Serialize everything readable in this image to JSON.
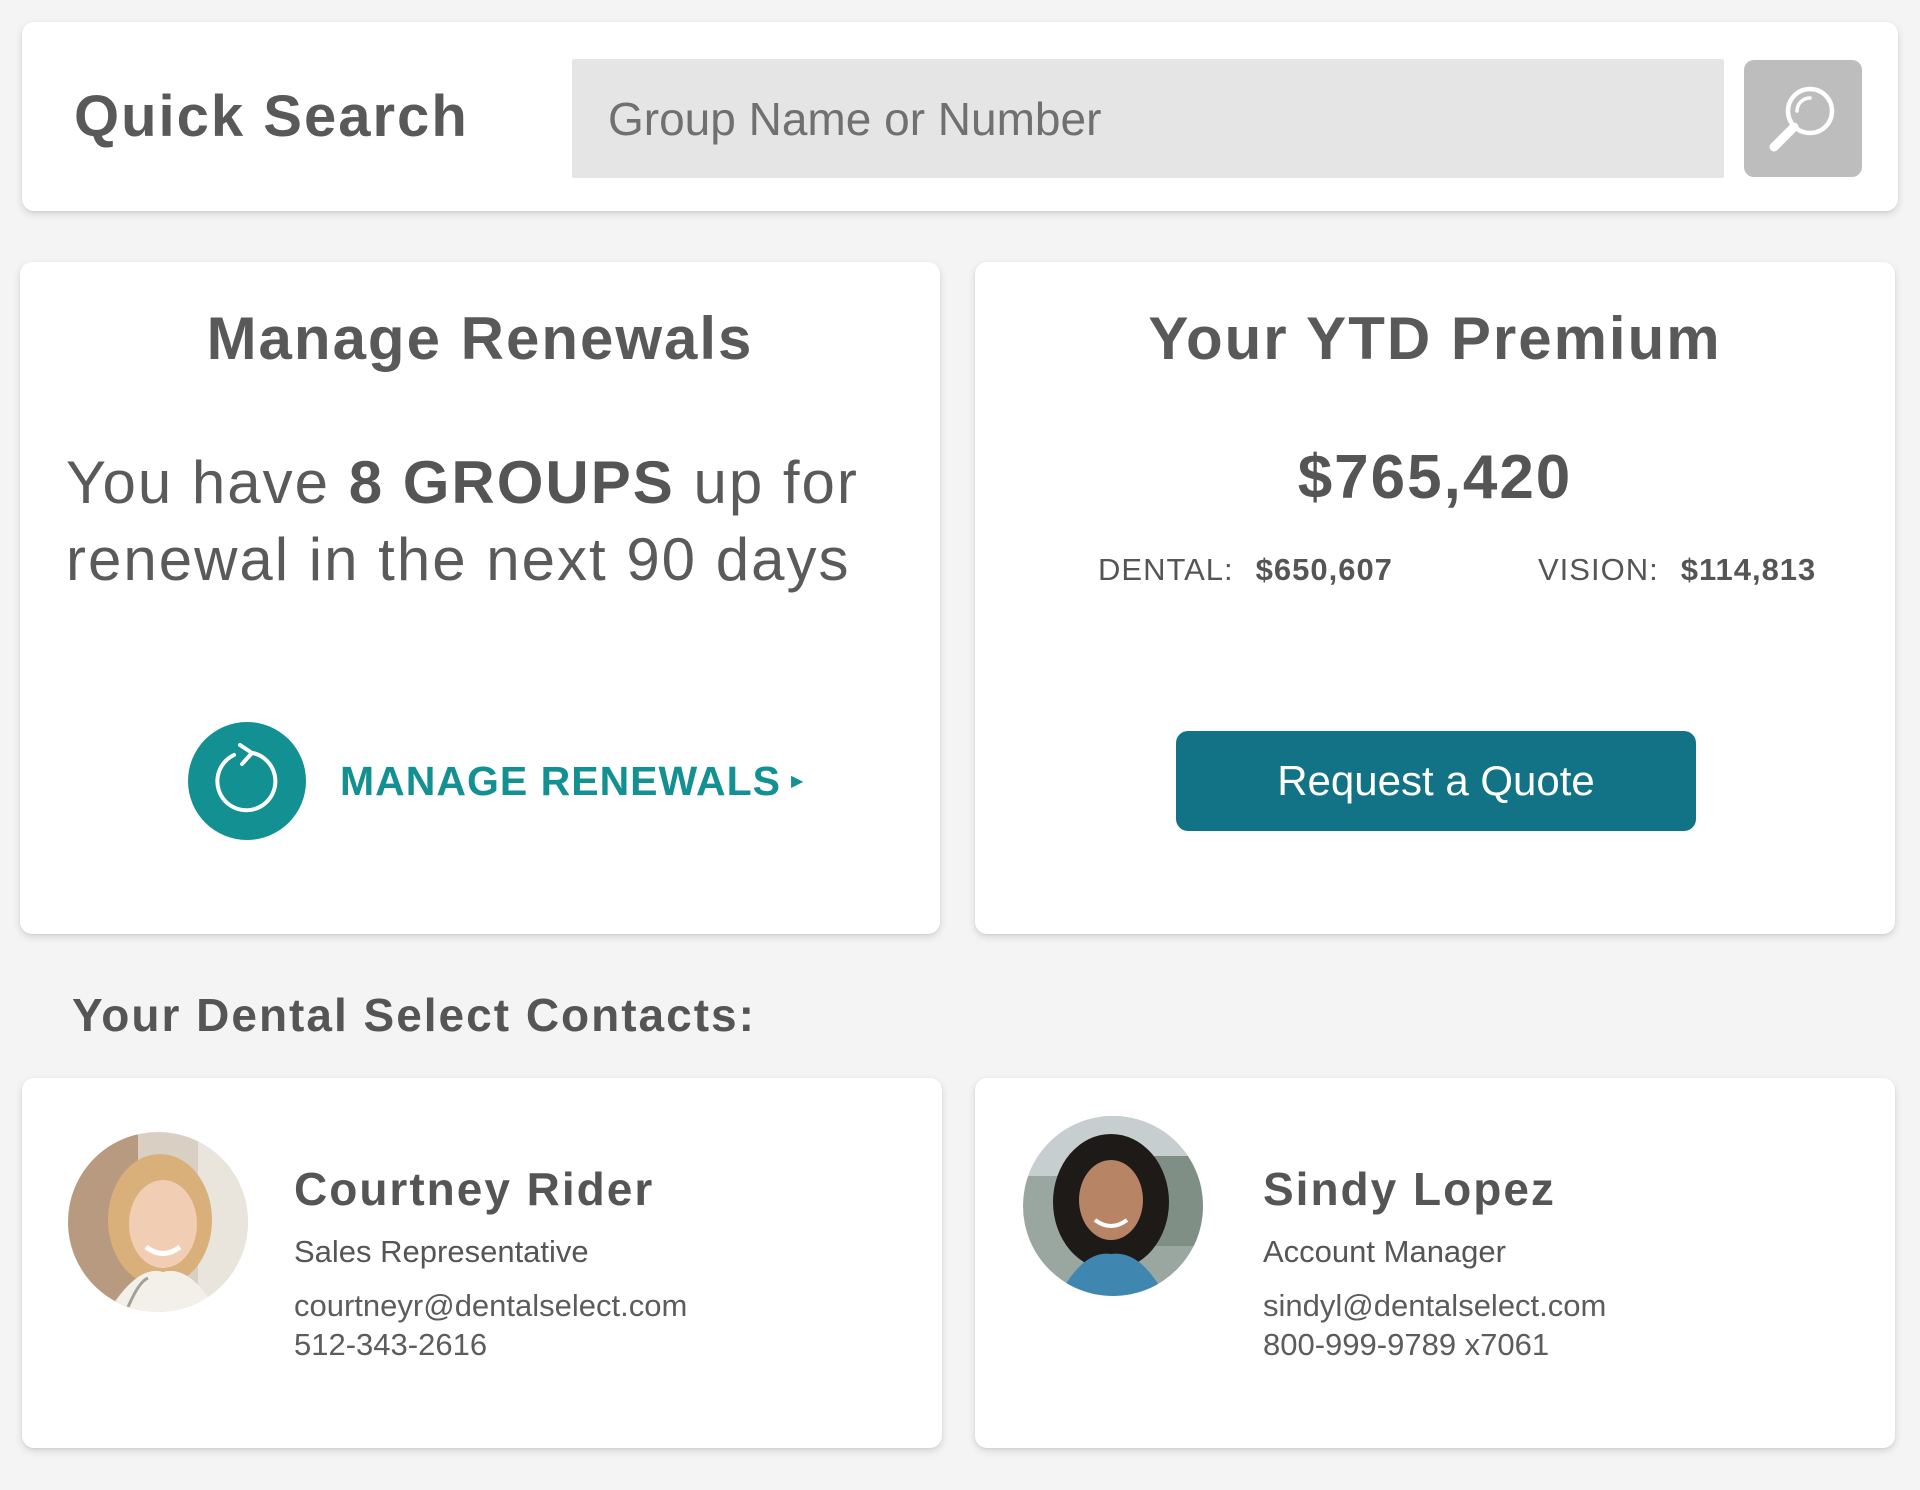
{
  "quick_search": {
    "label": "Quick Search",
    "placeholder": "Group Name or Number",
    "button_icon": "search-icon"
  },
  "renewals": {
    "title": "Manage Renewals",
    "text_prefix": "You have ",
    "group_count": "8 GROUPS",
    "text_suffix": " up for renewal in the next 90 days",
    "link_label": "MANAGE RENEWALS",
    "link_icon": "refresh-icon",
    "accent_color": "#139092"
  },
  "premium": {
    "title": "Your YTD Premium",
    "total": "$765,420",
    "dental_label": "DENTAL:",
    "dental_value": "$650,607",
    "vision_label": "VISION:",
    "vision_value": "$114,813",
    "quote_button": "Request a Quote",
    "button_color": "#137386"
  },
  "contacts": {
    "heading": "Your Dental Select Contacts:",
    "people": [
      {
        "name": "Courtney Rider",
        "role": "Sales Representative",
        "email": "courtneyr@dentalselect.com",
        "phone": "512-343-2616"
      },
      {
        "name": "Sindy Lopez",
        "role": "Account Manager",
        "email": "sindyl@dentalselect.com",
        "phone": "800-999-9789 x7061"
      }
    ]
  }
}
